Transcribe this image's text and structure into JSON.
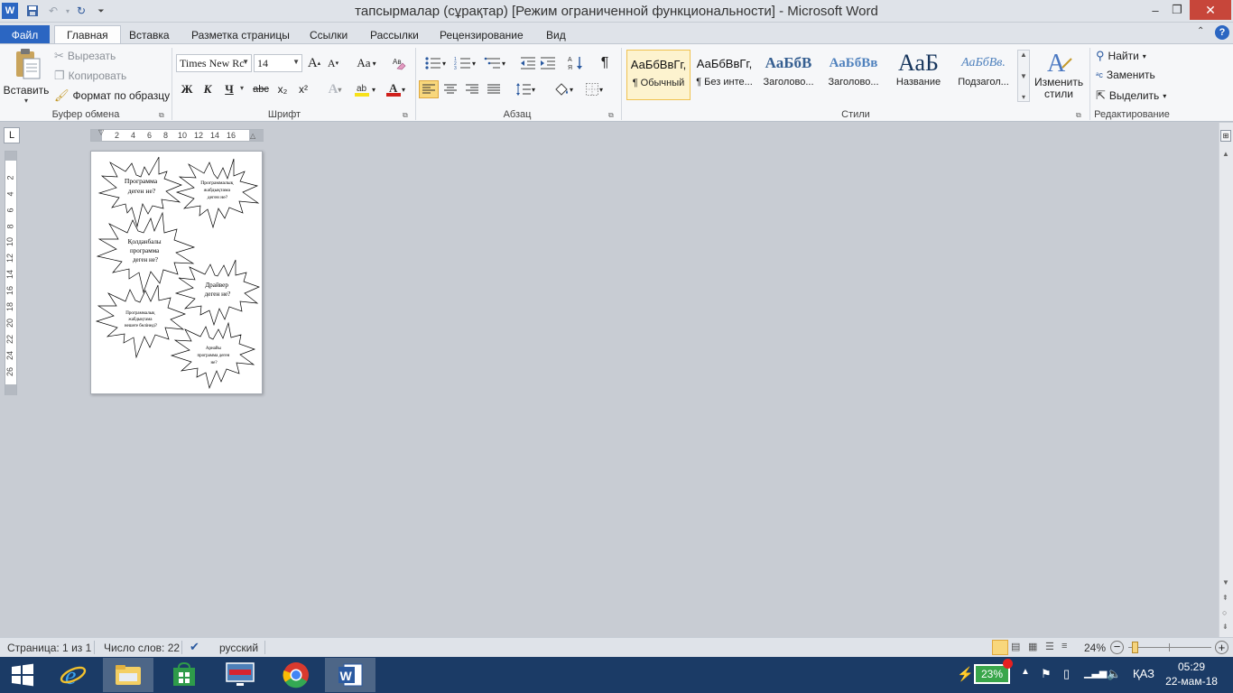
{
  "window": {
    "title": "тапсырмалар (сұрақтар) [Режим ограниченной функциональности]  -  Microsoft Word",
    "controls": {
      "minimize": "–",
      "restore": "❐",
      "close": "✕"
    }
  },
  "qat": {
    "word_icon": "W",
    "save_icon": "save-icon",
    "undo_icon": "↶",
    "redo_icon": "↻",
    "customize_icon": "⏷"
  },
  "tabs": [
    {
      "label": "Файл"
    },
    {
      "label": "Главная"
    },
    {
      "label": "Вставка"
    },
    {
      "label": "Разметка страницы"
    },
    {
      "label": "Ссылки"
    },
    {
      "label": "Рассылки"
    },
    {
      "label": "Рецензирование"
    },
    {
      "label": "Вид"
    }
  ],
  "ribbon": {
    "clipboard": {
      "paste_label": "Вставить",
      "cut_label": "Вырезать",
      "copy_label": "Копировать",
      "format_painter_label": "Формат по образцу",
      "group_label": "Буфер обмена"
    },
    "font": {
      "font_name": "Times New Rc",
      "font_size": "14",
      "grow": "A",
      "shrink": "A",
      "change_case": "Aa",
      "bold": "Ж",
      "italic": "К",
      "underline": "Ч",
      "strike": "abc",
      "subscript": "x₂",
      "superscript": "x²",
      "group_label": "Шрифт"
    },
    "paragraph": {
      "group_label": "Абзац",
      "pilcrow": "¶"
    },
    "styles": {
      "items": [
        {
          "sample": "АаБбВвГг,",
          "name": "¶ Обычный"
        },
        {
          "sample": "АаБбВвГг,",
          "name": "¶ Без инте..."
        },
        {
          "sample": "АаБбВ",
          "name": "Заголово..."
        },
        {
          "sample": "АаБбВв",
          "name": "Заголово..."
        },
        {
          "sample": "АаБ",
          "name": "Название"
        },
        {
          "sample": "АаБбВв.",
          "name": "Подзагол..."
        }
      ],
      "change_styles_line1": "Изменить",
      "change_styles_line2": "стили",
      "group_label": "Стили"
    },
    "editing": {
      "find_label": "Найти",
      "replace_label": "Заменить",
      "select_label": "Выделить",
      "group_label": "Редактирование"
    }
  },
  "rulers": {
    "horizontal_ticks": [
      "2",
      "4",
      "6",
      "8",
      "10",
      "12",
      "14",
      "16"
    ],
    "vertical_ticks": [
      "2",
      "4",
      "6",
      "8",
      "10",
      "12",
      "14",
      "16",
      "18",
      "20",
      "22",
      "24",
      "26"
    ]
  },
  "document": {
    "bursts": [
      {
        "line1": "Программа",
        "line2": "деген не?",
        "line3": ""
      },
      {
        "line1": "Программалық",
        "line2": "жабдықтама",
        "line3": "деген не?"
      },
      {
        "line1": "Қолданбалы",
        "line2": "программа",
        "line3": "деген не?"
      },
      {
        "line1": "Драйвер",
        "line2": "деген не?",
        "line3": ""
      },
      {
        "line1": "Программалық",
        "line2": "жабдықтама",
        "line3": "нешеге бөлінеді?"
      },
      {
        "line1": "Арнайы",
        "line2": "программа деген",
        "line3": "не?"
      }
    ]
  },
  "status": {
    "page": "Страница: 1 из 1",
    "words": "Число слов: 22",
    "language": "русский",
    "zoom": "24%",
    "zoom_fraction": 0.24
  },
  "taskbar": {
    "apps": [
      {
        "name": "start",
        "icon": "windows-icon"
      },
      {
        "name": "internet-explorer",
        "icon": "ie-icon"
      },
      {
        "name": "file-explorer",
        "icon": "folder-icon"
      },
      {
        "name": "store",
        "icon": "store-icon"
      },
      {
        "name": "lenovo",
        "icon": "lenovo-icon"
      },
      {
        "name": "chrome",
        "icon": "chrome-icon"
      },
      {
        "name": "word",
        "icon": "word-icon"
      }
    ],
    "battery": "23%",
    "language": "ҚАЗ",
    "time": "05:29",
    "date": "22-мам-18"
  },
  "colors": {
    "file_tab": "#2b66c2",
    "taskbar": "#1b3b66",
    "close_button": "#c7463a",
    "selected_style": "#fdf3cf",
    "font_color_red": "#d0201c",
    "highlight_yellow": "#f7e11a"
  }
}
